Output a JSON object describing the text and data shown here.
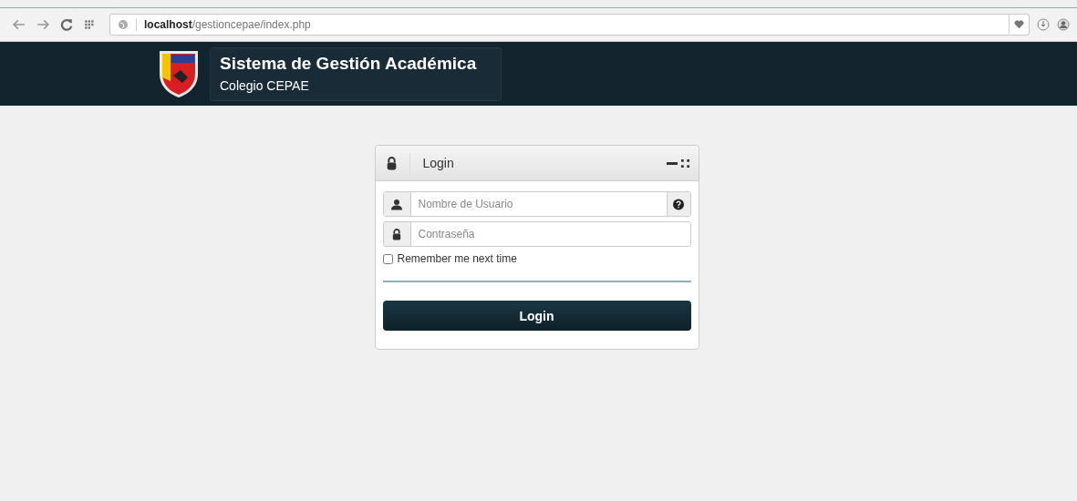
{
  "browser": {
    "url": "**localhost**/gestioncepae/index.php"
  },
  "header": {
    "title": "Sistema de Gestión Académica",
    "subtitle": "Colegio CEPAE"
  },
  "login_panel": {
    "title": "Login",
    "username": {
      "placeholder": "Nombre de Usuario"
    },
    "password": {
      "placeholder": "Contraseña"
    },
    "remember": {
      "label": "Remember me next time",
      "checked": false
    },
    "button": "Login"
  }
}
